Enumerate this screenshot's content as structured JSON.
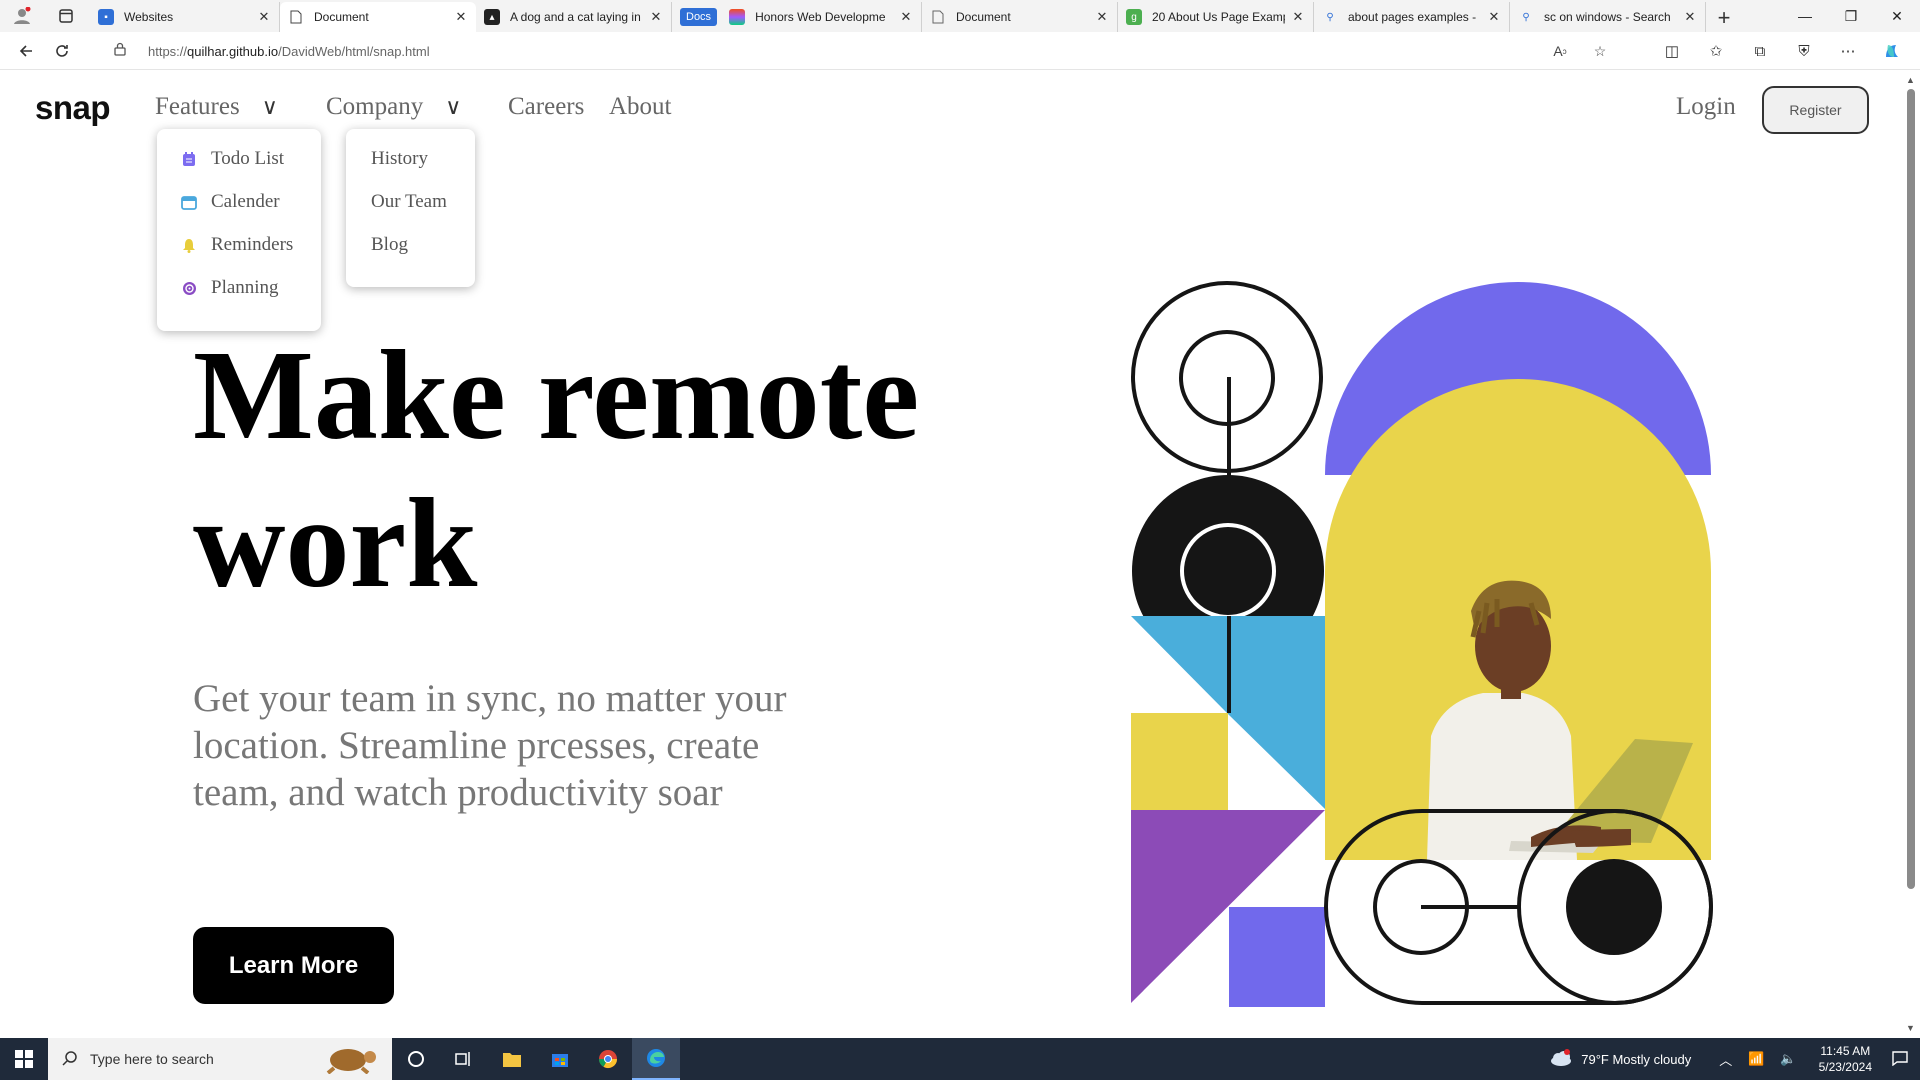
{
  "browser": {
    "tabs": [
      {
        "title": "Websites",
        "active": false
      },
      {
        "title": "Document",
        "active": true
      },
      {
        "title": "A dog and a cat laying in",
        "active": false
      },
      {
        "badge": "Docs",
        "title": "Honors Web Developme",
        "active": false
      },
      {
        "title": "Document",
        "active": false
      },
      {
        "title": "20 About Us Page Examp",
        "active": false
      },
      {
        "title": "about pages examples -",
        "active": false
      },
      {
        "title": "sc on windows - Search",
        "active": false
      }
    ],
    "url_prefix": "https://",
    "url_host": "quilhar.github.io",
    "url_path": "/DavidWeb/html/snap.html"
  },
  "site": {
    "logo": "snap",
    "nav": {
      "features": "Features",
      "company": "Company",
      "careers": "Careers",
      "about": "About",
      "chevron": "∨"
    },
    "login": "Login",
    "register": "Register",
    "features_menu": [
      {
        "label": "Todo List",
        "icon": "todo-icon",
        "color": "#7c6cf0"
      },
      {
        "label": "Calender",
        "icon": "calendar-icon",
        "color": "#4aa8dd"
      },
      {
        "label": "Reminders",
        "icon": "bell-icon",
        "color": "#e8cd3b"
      },
      {
        "label": "Planning",
        "icon": "planning-icon",
        "color": "#8a4cc4"
      }
    ],
    "company_menu": [
      "History",
      "Our Team",
      "Blog"
    ],
    "hero_title": "Make remote work",
    "hero_subtitle": "Get your team in sync, no matter your location. Streamline prcesses, create team, and watch productivity soar",
    "cta": "Learn More",
    "art_colors": {
      "purple": "#7169ec",
      "yellow": "#e9d44b",
      "blue": "#4aaedb",
      "violet": "#8c4bb7",
      "black": "#151515"
    }
  },
  "taskbar": {
    "search_placeholder": "Type here to search",
    "weather": "79°F  Mostly cloudy",
    "time": "11:45 AM",
    "date": "5/23/2024"
  }
}
